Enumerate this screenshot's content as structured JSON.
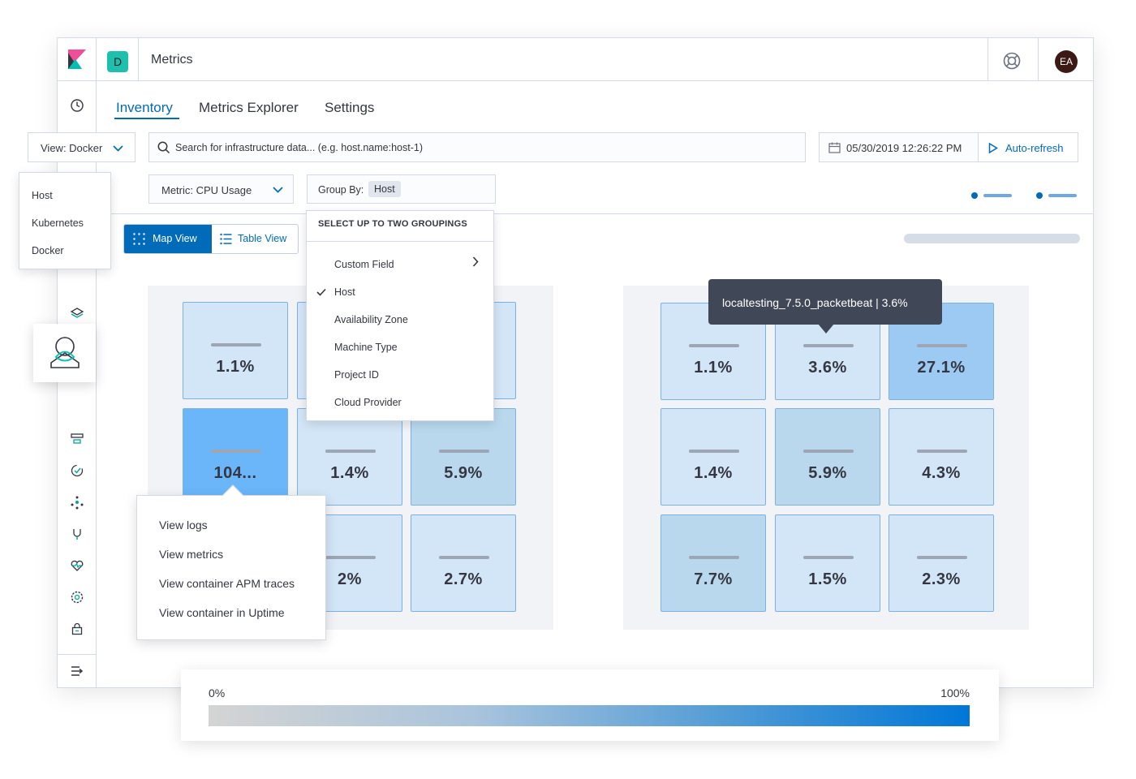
{
  "colors": {
    "accent": "#006bb8",
    "space_badge": "#1fbfae",
    "avatar_bg": "#3b1a14"
  },
  "header": {
    "space_initial": "D",
    "title": "Metrics",
    "avatar_initials": "EA"
  },
  "tabs": [
    {
      "label": "Inventory",
      "active": true
    },
    {
      "label": "Metrics Explorer",
      "active": false
    },
    {
      "label": "Settings",
      "active": false
    }
  ],
  "search": {
    "placeholder": "Search for infrastructure data... (e.g. host.name:host-1)"
  },
  "time": {
    "datetime": "05/30/2019  12:26:22  PM",
    "refresh_label": "Auto-refresh"
  },
  "view_select": {
    "label": "View: Docker",
    "options": [
      "Host",
      "Kubernetes",
      "Docker"
    ]
  },
  "metric_select": {
    "label": "Metric: CPU Usage"
  },
  "group_by": {
    "label": "Group By:",
    "value": "Host",
    "menu_title": "SELECT UP TO TWO GROUPINGS",
    "options": [
      "Custom Field",
      "Host",
      "Availability Zone",
      "Machine Type",
      "Project ID",
      "Cloud Provider"
    ],
    "selected": "Host"
  },
  "view_toggle": {
    "map_label": "Map View",
    "table_label": "Table View",
    "active": "map"
  },
  "left_map": {
    "nodes": [
      "1.1%",
      "",
      "",
      "104...",
      "1.4%",
      "5.9%",
      "",
      "2%",
      "2.7%"
    ]
  },
  "right_map": {
    "nodes": [
      "1.1%",
      "3.6%",
      "27.1%",
      "1.4%",
      "5.9%",
      "4.3%",
      "7.7%",
      "1.5%",
      "2.3%"
    ]
  },
  "tooltip": {
    "text": "localtesting_7.5.0_packetbeat | 3.6%"
  },
  "context_menu": {
    "items": [
      "View logs",
      "View metrics",
      "View container APM traces",
      "View container in Uptime"
    ]
  },
  "legend": {
    "min": "0%",
    "max": "100%"
  }
}
